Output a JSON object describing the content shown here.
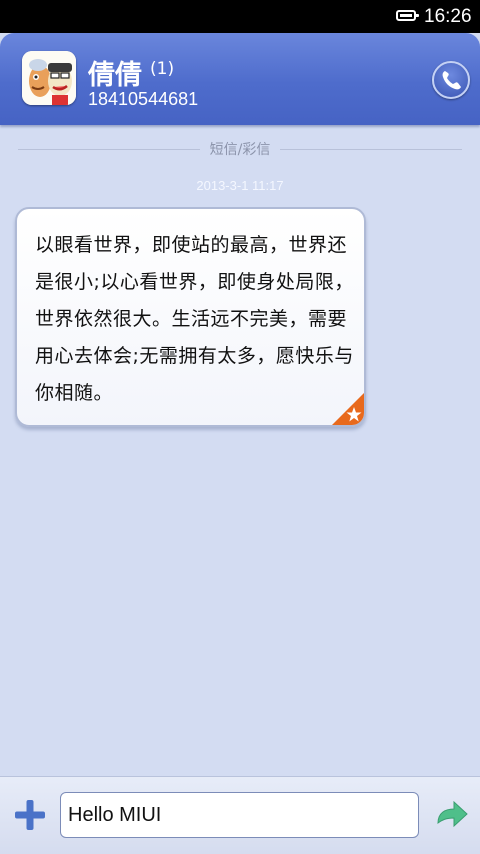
{
  "status_bar": {
    "time": "16:26",
    "battery_icon": "battery-icon"
  },
  "header": {
    "contact_name": "倩倩",
    "unread_count": "(1)",
    "phone_number": "18410544681",
    "avatar_icon": "cartoon-avatar-icon",
    "call_icon": "phone-icon"
  },
  "conversation": {
    "divider_label": "短信/彩信",
    "timestamp": "2013-3-1 11:17",
    "messages": [
      {
        "text": "以眼看世界，即使站的最高，世界还是很小;以心看世界，即使身处局限，世界依然很大。生活远不完美，需要用心去体会;无需拥有太多，愿快乐与你相随。",
        "badge_icon": "star-icon"
      }
    ]
  },
  "composer": {
    "input_value": "Hello MIUI",
    "add_icon": "plus-icon",
    "send_icon": "send-arrow-icon"
  },
  "colors": {
    "header_blue": "#4e6ccc",
    "background": "#d3dcf2",
    "badge_orange": "#e8691c",
    "send_green": "#4fbf8a",
    "add_blue": "#4a72c8"
  }
}
